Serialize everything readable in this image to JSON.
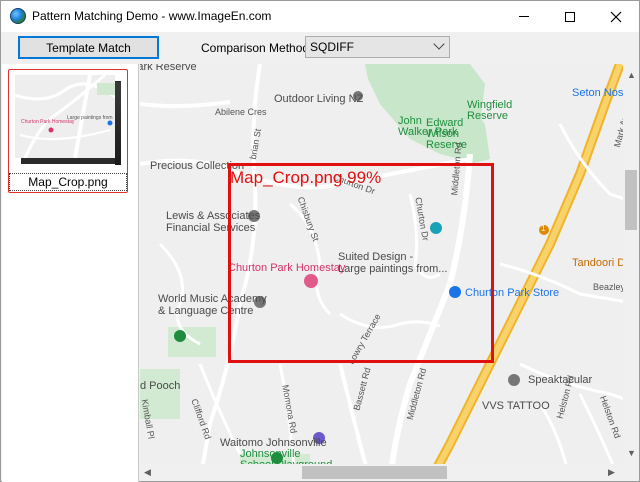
{
  "window": {
    "title": "Pattern Matching Demo - www.ImageEn.com"
  },
  "toolbar": {
    "template_match_label": "Template Match",
    "comparison_label": "Comparison Method:",
    "comparison_value": "SQDIFF"
  },
  "thumbnails": [
    {
      "caption": "Map_Crop.png"
    }
  ],
  "match": {
    "label": "Map_Crop.png 99%"
  },
  "map": {
    "labels": {
      "park_reserve": "Park Reserve",
      "outdoor_living": "Outdoor Living NZ",
      "abilene_cres": "Abilene Cres",
      "john_walker_park": "John\nWalker Park",
      "edward_wilson": "Edward\nWilson\nReserve",
      "wingfield": "Wingfield\nReserve",
      "seton_nossi": "Seton Nossi",
      "mark_ave": "Mark Ave",
      "precious_collection": "Precious Collection",
      "lewis_associates": "Lewis & Associates\nFinancial Services",
      "churton_park_homestay": "Churton Park Homestay",
      "suited_design": "Suited Design -\nLarge paintings from...",
      "churton_park_store": "Churton Park Store",
      "tandoori": "Tandoori Dh",
      "beazley": "Beazley",
      "world_music": "World Music Academy\n& Language Centre",
      "pooch": "d Pooch",
      "speaktacular": "Speaktacular",
      "vvs_tattoo": "VVS TATTOO",
      "waitomo": "Waitomo Johnsonville",
      "johnsonville_school": "Johnsonville\nSchool Playground",
      "churton_dr": "Churton Dr",
      "churton_dr2": "Churton Dr",
      "middleton_rd": "Middleton Rd",
      "middleton_rd2": "Middleton Rd",
      "chisbury_st": "Chisbury St",
      "brian_st": "brian St",
      "bassett_rd": "Bassett Rd",
      "momona_rd": "Momona Rd",
      "clifford_rd": "Clifford Rd",
      "kimball_pl": "Kimball Pl",
      "helston_rd": "Helston Rd",
      "heston_rd": "Helston Rd",
      "lowry_terrace": "Lowry Terrace",
      "route_1": "1"
    }
  },
  "colors": {
    "accent": "#0078d7",
    "match": "#e01010",
    "park": "#c8e6c9",
    "motorway": "#f6c544"
  }
}
